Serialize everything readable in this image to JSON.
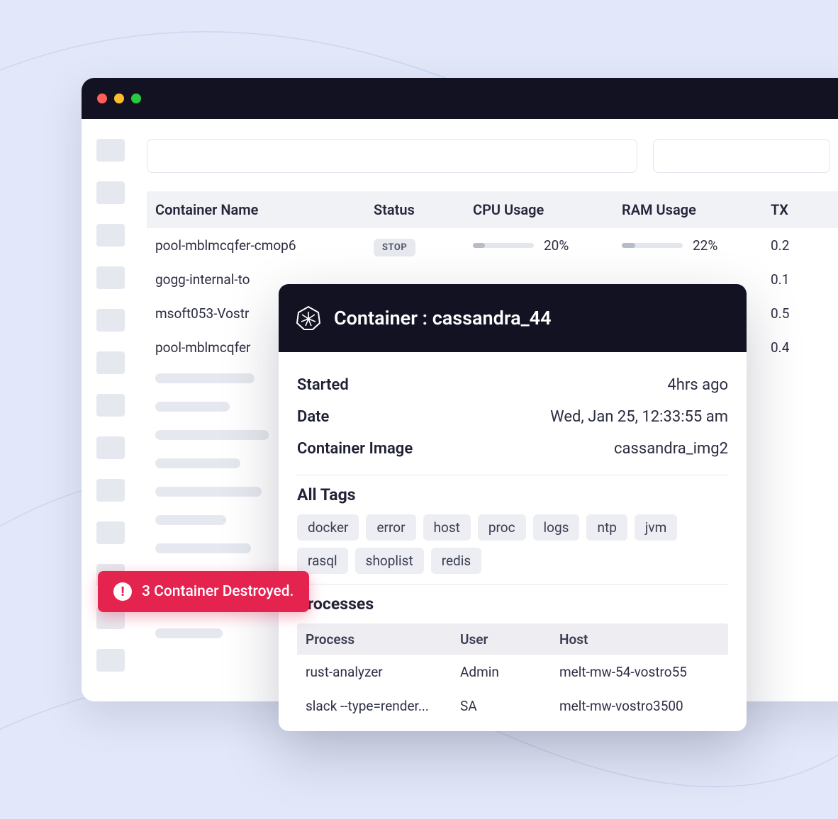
{
  "window": {
    "traffic_lights": [
      "red",
      "yellow",
      "green"
    ]
  },
  "search": {
    "primary_placeholder": "",
    "secondary_placeholder": ""
  },
  "table": {
    "headers": {
      "name": "Container Name",
      "status": "Status",
      "cpu": "CPU Usage",
      "ram": "RAM Usage",
      "tx": "TX"
    },
    "rows": [
      {
        "name": "pool-mblmcqfer-cmop6",
        "status": "STOP",
        "cpu_pct": "20%",
        "cpu_fill": 20,
        "ram_pct": "22%",
        "ram_fill": 22,
        "tx": "0.2"
      },
      {
        "name": "gogg-internal-to",
        "tx": "0.1"
      },
      {
        "name": "msoft053-Vostr",
        "tx": "0.5"
      },
      {
        "name": "pool-mblmcqfer",
        "tx": "0.4"
      }
    ]
  },
  "detail": {
    "title": "Container : cassandra_44",
    "kv": {
      "started_label": "Started",
      "started_value": "4hrs ago",
      "date_label": "Date",
      "date_value": "Wed, Jan 25, 12:33:55 am",
      "image_label": "Container Image",
      "image_value": "cassandra_img2"
    },
    "tags_title": "All Tags",
    "tags": [
      "docker",
      "error",
      "host",
      "proc",
      "logs",
      "ntp",
      "jvm",
      "rasql",
      "shoplist",
      "redis"
    ],
    "processes_title": "Processes",
    "proc_headers": {
      "process": "Process",
      "user": "User",
      "host": "Host"
    },
    "processes": [
      {
        "process": "rust-analyzer",
        "user": "Admin",
        "host": "melt-mw-54-vostro55"
      },
      {
        "process": "slack --type=render...",
        "user": "SA",
        "host": "melt-mw-vostro3500"
      }
    ]
  },
  "alert": {
    "text": "3 Container Destroyed."
  }
}
